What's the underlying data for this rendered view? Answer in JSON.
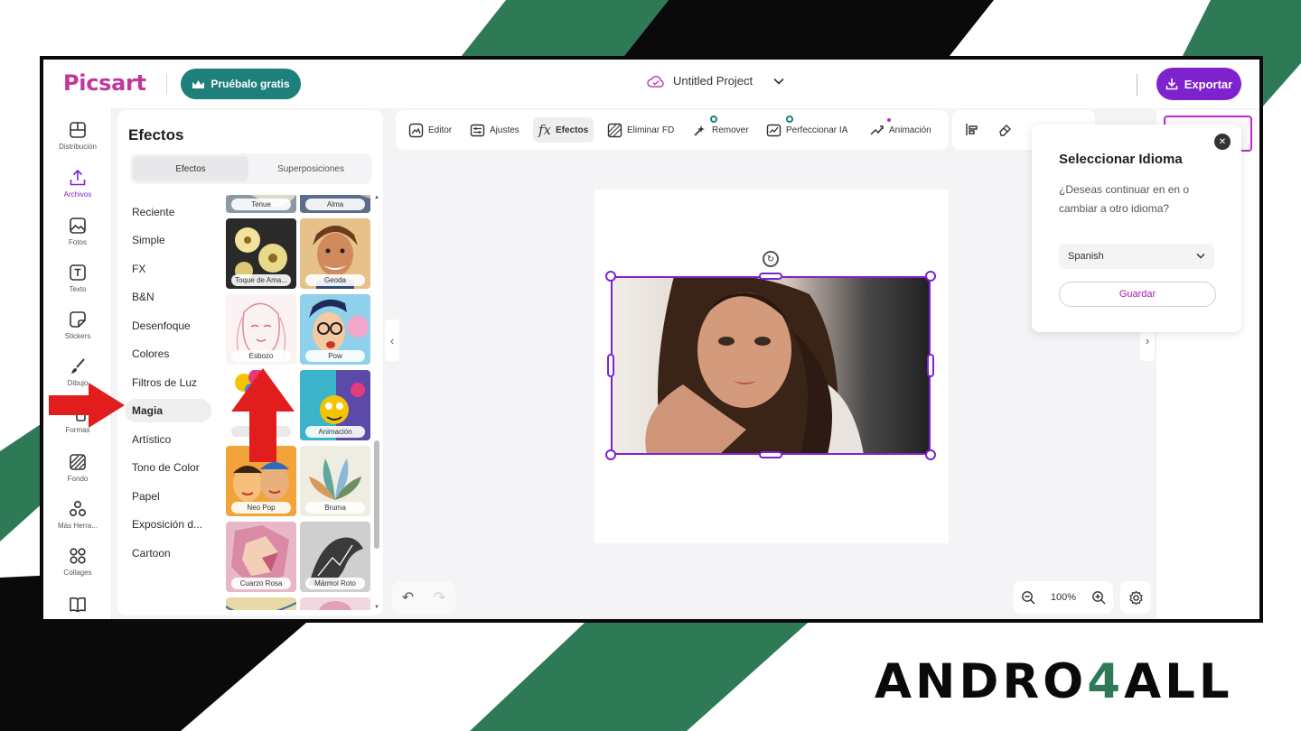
{
  "colors": {
    "brand_pink": "#c1379c",
    "accent_purple": "#7e22ce",
    "trial_teal": "#1f7f7b",
    "stripe_green": "#2f7a56",
    "arrow_red": "#e11d1d"
  },
  "header": {
    "logo": "Picsart",
    "trial_button": "Pruébalo gratis",
    "project_name": "Untitled Project",
    "export_button": "Exportar"
  },
  "rail": {
    "items": [
      {
        "label": "Distribución",
        "icon": "layout-icon"
      },
      {
        "label": "Archivos",
        "icon": "upload-icon"
      },
      {
        "label": "Fotos",
        "icon": "image-icon"
      },
      {
        "label": "Texto",
        "icon": "text-icon"
      },
      {
        "label": "Stickers",
        "icon": "sticker-icon"
      },
      {
        "label": "Dibujo",
        "icon": "brush-icon"
      },
      {
        "label": "Formas",
        "icon": "shapes-icon"
      },
      {
        "label": "Fondo",
        "icon": "background-icon"
      },
      {
        "label": "Más Herra...",
        "icon": "more-tools-icon"
      },
      {
        "label": "Collages",
        "icon": "collage-icon"
      }
    ]
  },
  "panel": {
    "title": "Efectos",
    "tabs": [
      "Efectos",
      "Superposiciones"
    ],
    "categories": [
      "Reciente",
      "Simple",
      "FX",
      "B&N",
      "Desenfoque",
      "Colores",
      "Filtros de Luz",
      "Magia",
      "Artístico",
      "Tono de Color",
      "Papel",
      "Exposición d...",
      "Cartoon"
    ],
    "selected_category": "Magia",
    "thumbs": [
      "Tenue",
      "Alma",
      "Toque de Ama...",
      "Geoda",
      "Esbozo",
      "Pow",
      "",
      "Animación",
      "Neo Pop",
      "Bruma",
      "Cuarzo Rosa",
      "Mármol Roto"
    ]
  },
  "toolbar": {
    "tools": [
      "Editor",
      "Ajustes",
      "Efectos",
      "Eliminar FD",
      "Remover",
      "Perfeccionar IA",
      "Animación"
    ],
    "active_tool": "Efectos"
  },
  "zoom": {
    "level": "100%"
  },
  "language_dialog": {
    "title": "Seleccionar Idioma",
    "message": "¿Deseas continuar en en o cambiar a otro idioma?",
    "selected": "Spanish",
    "save_button": "Guardar"
  },
  "watermark": {
    "part1": "ANDRO",
    "part2": "4",
    "part3": "ALL"
  }
}
